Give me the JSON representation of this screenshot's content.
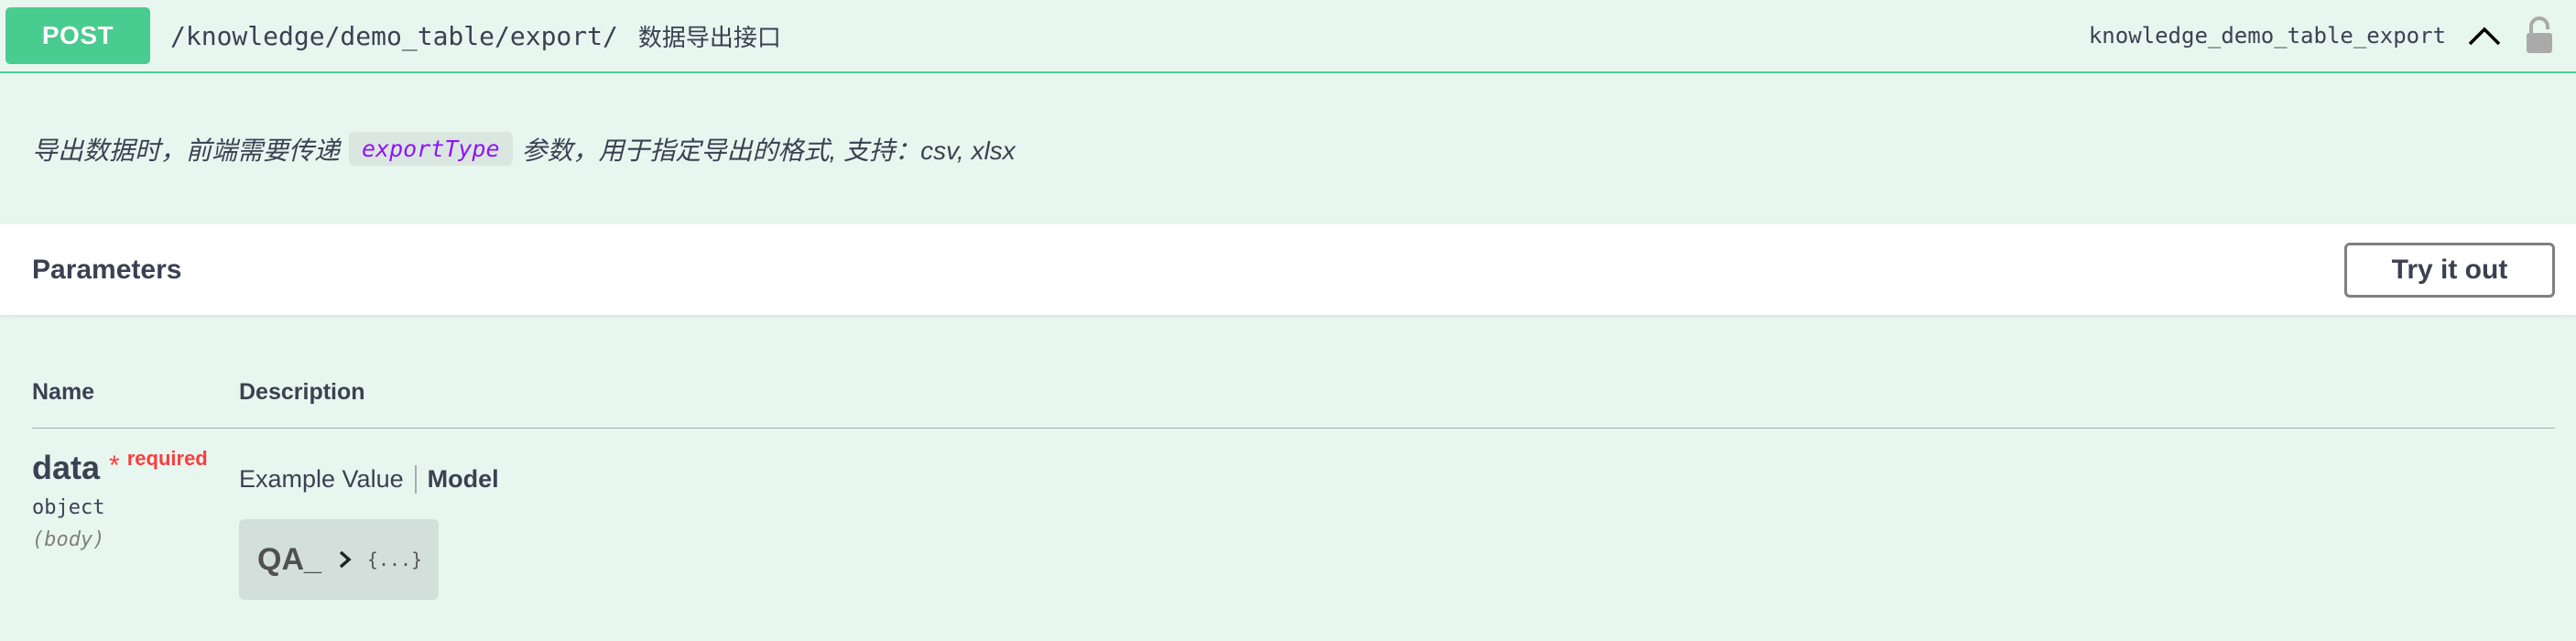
{
  "summary": {
    "method": "POST",
    "path": "/knowledge/demo_table/export/",
    "description": "数据导出接口",
    "operation_id": "knowledge_demo_table_export"
  },
  "description": {
    "prefix": "导出数据时，前端需要传递",
    "code": "exportType",
    "suffix": "参数，用于指定导出的格式, 支持：csv, xlsx"
  },
  "parameters": {
    "title": "Parameters",
    "try_label": "Try it out",
    "headers": {
      "name": "Name",
      "description": "Description"
    },
    "items": [
      {
        "name": "data",
        "required_star": "*",
        "required_label": "required",
        "type": "object",
        "in": "(body)",
        "tab_example": "Example Value",
        "tab_model": "Model",
        "model_name": "QA_",
        "model_preview": "{...}"
      }
    ]
  },
  "colors": {
    "accent": "#49cc90",
    "background": "#e8f6f0",
    "required": "#f93e3e",
    "code": "#9012fe"
  },
  "icons": {
    "collapse": "chevron-up-icon",
    "lock": "lock-icon",
    "model_expand": "chevron-right-icon"
  }
}
